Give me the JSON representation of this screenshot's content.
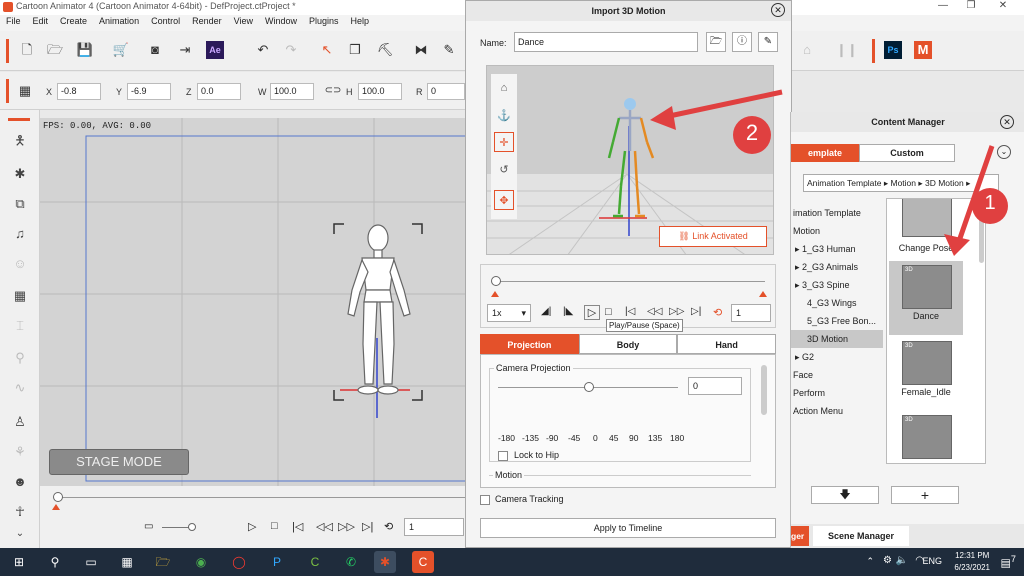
{
  "window": {
    "title": "Cartoon Animator 4  (Cartoon Animator 4-64bit) - DefProject.ctProject *"
  },
  "menu": [
    "File",
    "Edit",
    "Create",
    "Animation",
    "Control",
    "Render",
    "View",
    "Window",
    "Plugins",
    "Help"
  ],
  "toolbar": {
    "ae_label": "Ae",
    "ps_label": "Ps",
    "m_label": "M"
  },
  "transform": {
    "x_label": "X",
    "x_value": "-0.8",
    "y_label": "Y",
    "y_value": "-6.9",
    "z_label": "Z",
    "z_value": "0.0",
    "w_label": "W",
    "w_value": "100.0",
    "h_label": "H",
    "h_value": "100.0",
    "r_label": "R",
    "r_value": "0"
  },
  "stage": {
    "fps": "FPS: 0.00, AVG: 0.00",
    "mode": "STAGE MODE",
    "frame": "1"
  },
  "dialog": {
    "title": "Import 3D Motion",
    "name_label": "Name:",
    "name_value": "Dance",
    "link_label": "Link Activated",
    "speed": "1x",
    "frame": "1",
    "tooltip": "Play/Pause (Space)",
    "tabs": [
      "Projection",
      "Body",
      "Hand"
    ],
    "camera_projection_label": "Camera Projection",
    "camera_projection_value": "0",
    "scale_ticks": [
      "-180",
      "-135",
      "-90",
      "-45",
      "0",
      "45",
      "90",
      "135",
      "180"
    ],
    "lock_to_hip": "Lock to Hip",
    "motion_label": "Motion",
    "camera_tracking": "Camera Tracking",
    "apply": "Apply to Timeline"
  },
  "annotations": {
    "num1": "1",
    "num2": "2"
  },
  "content_manager": {
    "title": "Content Manager",
    "tab_template": "Template",
    "tab_template_visible": "emplate",
    "tab_custom": "Custom",
    "breadcrumb": "Animation Template ▸ Motion ▸ 3D Motion ▸",
    "tree": [
      "imation Template",
      "Motion",
      "1_G3 Human",
      "2_G3 Animals",
      "3_G3 Spine",
      "4_G3 Wings",
      "5_G3 Free Bon...",
      "3D Motion",
      "G2",
      "Face",
      "Perform",
      "Action Menu"
    ],
    "thumbs": [
      "Change Pose",
      "Dance",
      "Female_Idle",
      ""
    ],
    "badge_3d": "3D",
    "bottom_tab1": "ger",
    "bottom_tab2": "Scene Manager"
  },
  "taskbar": {
    "lang": "ENG",
    "time": "12:31 PM",
    "date": "6/23/2021",
    "notif": "7"
  },
  "colors": {
    "accent": "#e4512a",
    "annotation": "#e04040",
    "taskbar": "#1f2c3c"
  }
}
